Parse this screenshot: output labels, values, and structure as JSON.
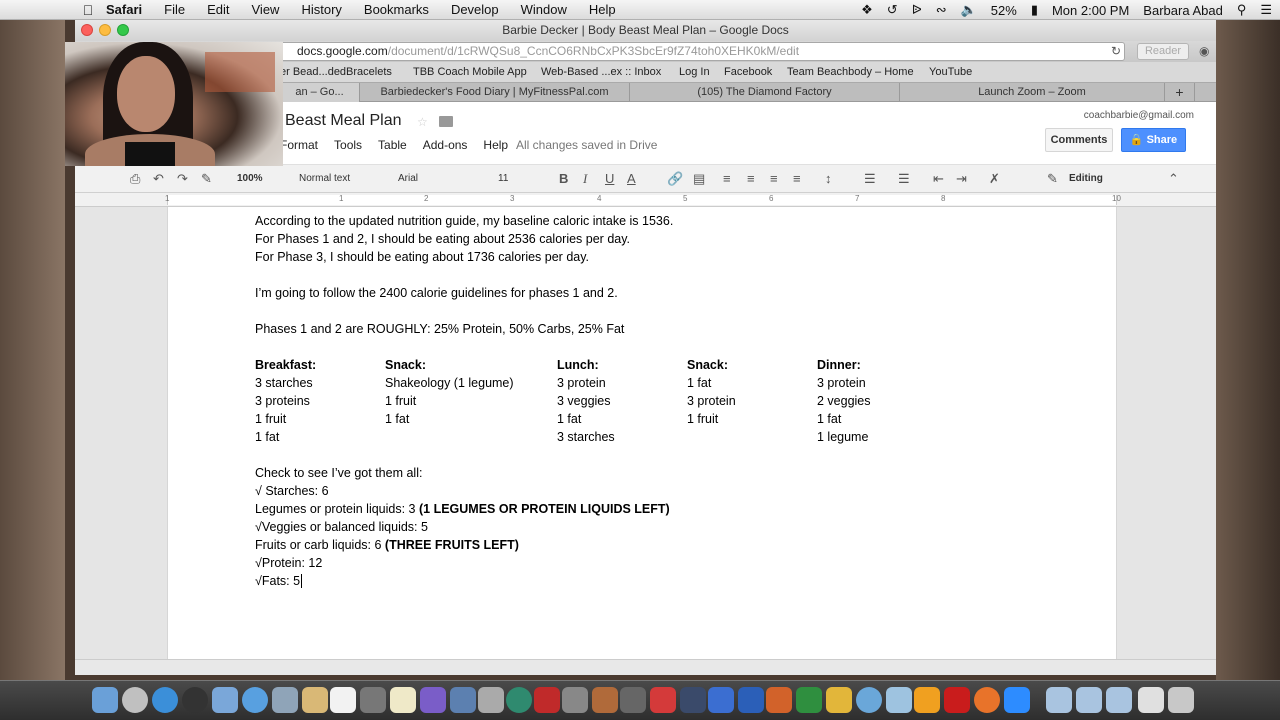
{
  "menubar": {
    "app": "Safari",
    "items": [
      "File",
      "Edit",
      "View",
      "History",
      "Bookmarks",
      "Develop",
      "Window",
      "Help"
    ],
    "battery": "52%",
    "clock": "Mon 2:00 PM",
    "user": "Barbara Abad"
  },
  "window": {
    "title": "Barbie Decker | Body Beast Meal Plan – Google Docs",
    "url_host": "docs.google.com",
    "url_path": "/document/d/1cRWQSu8_CcnCO6RNbCxPK3SbcEr9fZ74toh0XEHK0kM/edit",
    "reader": "Reader"
  },
  "bookmarks": [
    "er Bead...dedBracelets",
    "TBB Coach Mobile App",
    "Web-Based ...ex :: Inbox",
    "Log In",
    "Facebook",
    "Team Beachbody – Home",
    "YouTube"
  ],
  "tabs": [
    "an – Go...",
    "Barbiedecker's Food Diary | MyFitnessPal.com",
    "(105) The Diamond Factory",
    "Launch Zoom – Zoom"
  ],
  "docs": {
    "title": "Beast Meal Plan",
    "menus": [
      "Format",
      "Tools",
      "Table",
      "Add-ons",
      "Help"
    ],
    "saved": "All changes saved in Drive",
    "account": "coachbarbie@gmail.com",
    "comments": "Comments",
    "share": "Share",
    "toolbar": {
      "zoom": "100%",
      "style": "Normal text",
      "font": "Arial",
      "size": "11",
      "mode": "Editing"
    },
    "ruler_ticks": [
      "1",
      "1",
      "2",
      "3",
      "4",
      "5",
      "6",
      "7",
      "8",
      "10"
    ]
  },
  "content": {
    "intro": [
      "According to the updated nutrition guide, my baseline caloric intake is 1536.",
      "For Phases 1 and 2, I should be eating about 2536 calories per day.",
      "For Phase 3, I should be eating about 1736 calories per day."
    ],
    "follow": "I’m going to follow the 2400 calorie guidelines for phases 1 and 2.",
    "ratio": "Phases 1 and 2 are ROUGHLY: 25% Protein, 50% Carbs, 25% Fat",
    "meals": [
      {
        "name": "Breakfast:",
        "items": [
          "3 starches",
          "3 proteins",
          "1 fruit",
          "1 fat"
        ]
      },
      {
        "name": "Snack:",
        "items": [
          "Shakeology (1 legume)",
          "1 fruit",
          "1 fat"
        ]
      },
      {
        "name": "Lunch:",
        "items": [
          "3 protein",
          "3 veggies",
          "1 fat",
          "3 starches"
        ]
      },
      {
        "name": "Snack:",
        "items": [
          "1 fat",
          "3 protein",
          "1 fruit"
        ]
      },
      {
        "name": "Dinner:",
        "items": [
          "3 protein",
          "2 veggies",
          "1 fat",
          "1 legume"
        ]
      }
    ],
    "check_title": "Check to see I’ve got them all:",
    "checks": [
      {
        "text": "√ Starches: 6",
        "note": ""
      },
      {
        "text": "Legumes or protein liquids: 3 ",
        "note": "(1 LEGUMES OR PROTEIN LIQUIDS LEFT)"
      },
      {
        "text": "√Veggies or balanced liquids: 5",
        "note": ""
      },
      {
        "text": "Fruits or carb liquids: 6 ",
        "note": "(THREE FRUITS LEFT)"
      },
      {
        "text": "√Protein: 12",
        "note": ""
      },
      {
        "text": "√Fats: 5",
        "note": ""
      }
    ]
  },
  "colors": {
    "share_blue": "#4d90fe",
    "page_bg": "#ffffff",
    "canvas_bg": "#e5e5e5"
  }
}
